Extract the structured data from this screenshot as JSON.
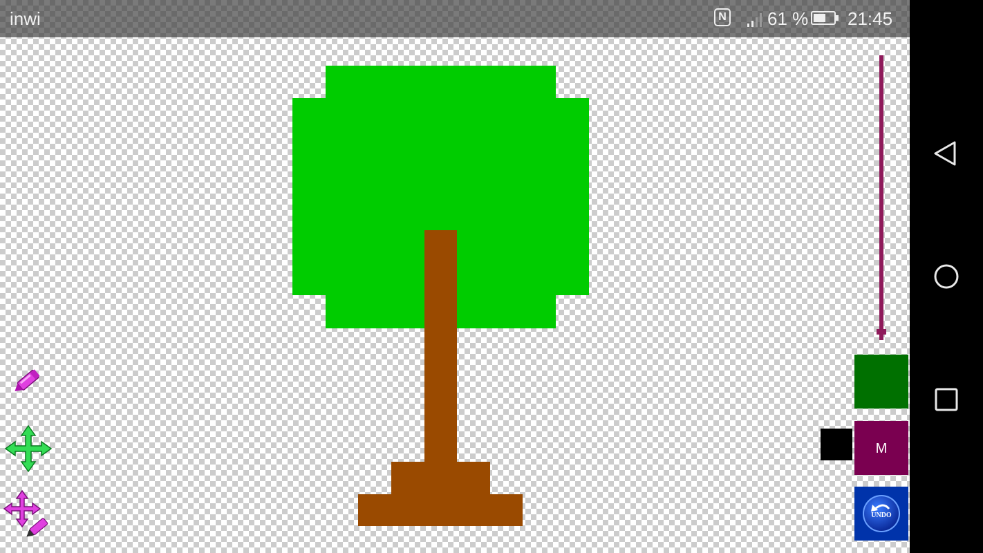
{
  "status_bar": {
    "carrier": "inwi",
    "nfc": "N",
    "battery": "61 %",
    "battery_level": 0.61,
    "time": "21:45"
  },
  "tools": {
    "brush_icon": "marker-pen-icon",
    "move_icon": "move-arrows-icon",
    "move_draw_icon": "move-draw-icon"
  },
  "palette": {
    "primary_color": "#007000",
    "secondary_color": "#000000",
    "mode_color": "#7a0050",
    "mode_label": "M",
    "undo_label": "UNDO"
  },
  "canvas": {
    "tree_leaves_color": "#00cc00",
    "tree_trunk_color": "#9a4a00"
  },
  "nav": {
    "back_icon": "back-triangle-icon",
    "home_icon": "home-circle-icon",
    "recents_icon": "recents-square-icon"
  }
}
